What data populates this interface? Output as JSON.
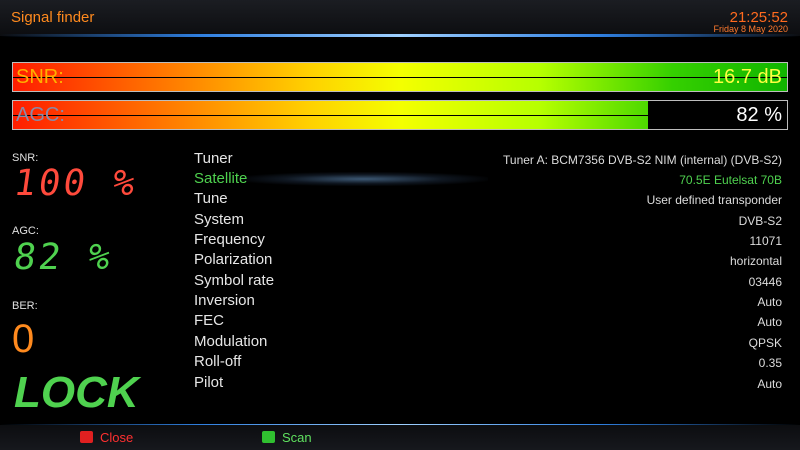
{
  "header": {
    "title": "Signal finder",
    "time": "21:25:52",
    "date": "Friday  8 May 2020"
  },
  "bars": {
    "snr": {
      "label": "SNR:",
      "value": "16.7 dB",
      "fill_fraction": 1.0,
      "label_color": "#ffb000",
      "value_color": "#ffff40"
    },
    "agc": {
      "label": "AGC:",
      "value": "82 %",
      "fill_fraction": 0.82,
      "label_color": "#8a8aa8",
      "value_color": "#ffffff"
    }
  },
  "readouts": {
    "snr": {
      "label": "SNR:",
      "value": "100 %",
      "color": "#ff4a3c"
    },
    "agc": {
      "label": "AGC:",
      "value": "82 %",
      "color": "#4fd24f"
    },
    "ber": {
      "label": "BER:",
      "value": "0",
      "color": "#ff8a1e"
    },
    "lock": "LOCK"
  },
  "info": [
    {
      "label": "Tuner",
      "value": "Tuner A: BCM7356 DVB-S2 NIM (internal) (DVB-S2)",
      "selected": false
    },
    {
      "label": "Satellite",
      "value": "70.5E Eutelsat 70B",
      "selected": true
    },
    {
      "label": "Tune",
      "value": "User defined transponder",
      "selected": false
    },
    {
      "label": "System",
      "value": "DVB-S2",
      "selected": false
    },
    {
      "label": "Frequency",
      "value": "11071",
      "selected": false
    },
    {
      "label": "Polarization",
      "value": "horizontal",
      "selected": false
    },
    {
      "label": "Symbol rate",
      "value": "03446",
      "selected": false
    },
    {
      "label": "Inversion",
      "value": "Auto",
      "selected": false
    },
    {
      "label": "FEC",
      "value": "Auto",
      "selected": false
    },
    {
      "label": "Modulation",
      "value": "QPSK",
      "selected": false
    },
    {
      "label": "Roll-off",
      "value": "0.35",
      "selected": false
    },
    {
      "label": "Pilot",
      "value": "Auto",
      "selected": false
    }
  ],
  "footer": {
    "close": {
      "label": "Close",
      "key_color": "#e02020",
      "label_color": "#ff3030",
      "icon": "red-key-icon"
    },
    "scan": {
      "label": "Scan",
      "key_color": "#30c030",
      "label_color": "#5fe05f",
      "icon": "green-key-icon"
    }
  },
  "colors": {
    "accent": "#ff8a1e",
    "highlight": "#4fd24f",
    "glow": "#2f7fe0"
  }
}
